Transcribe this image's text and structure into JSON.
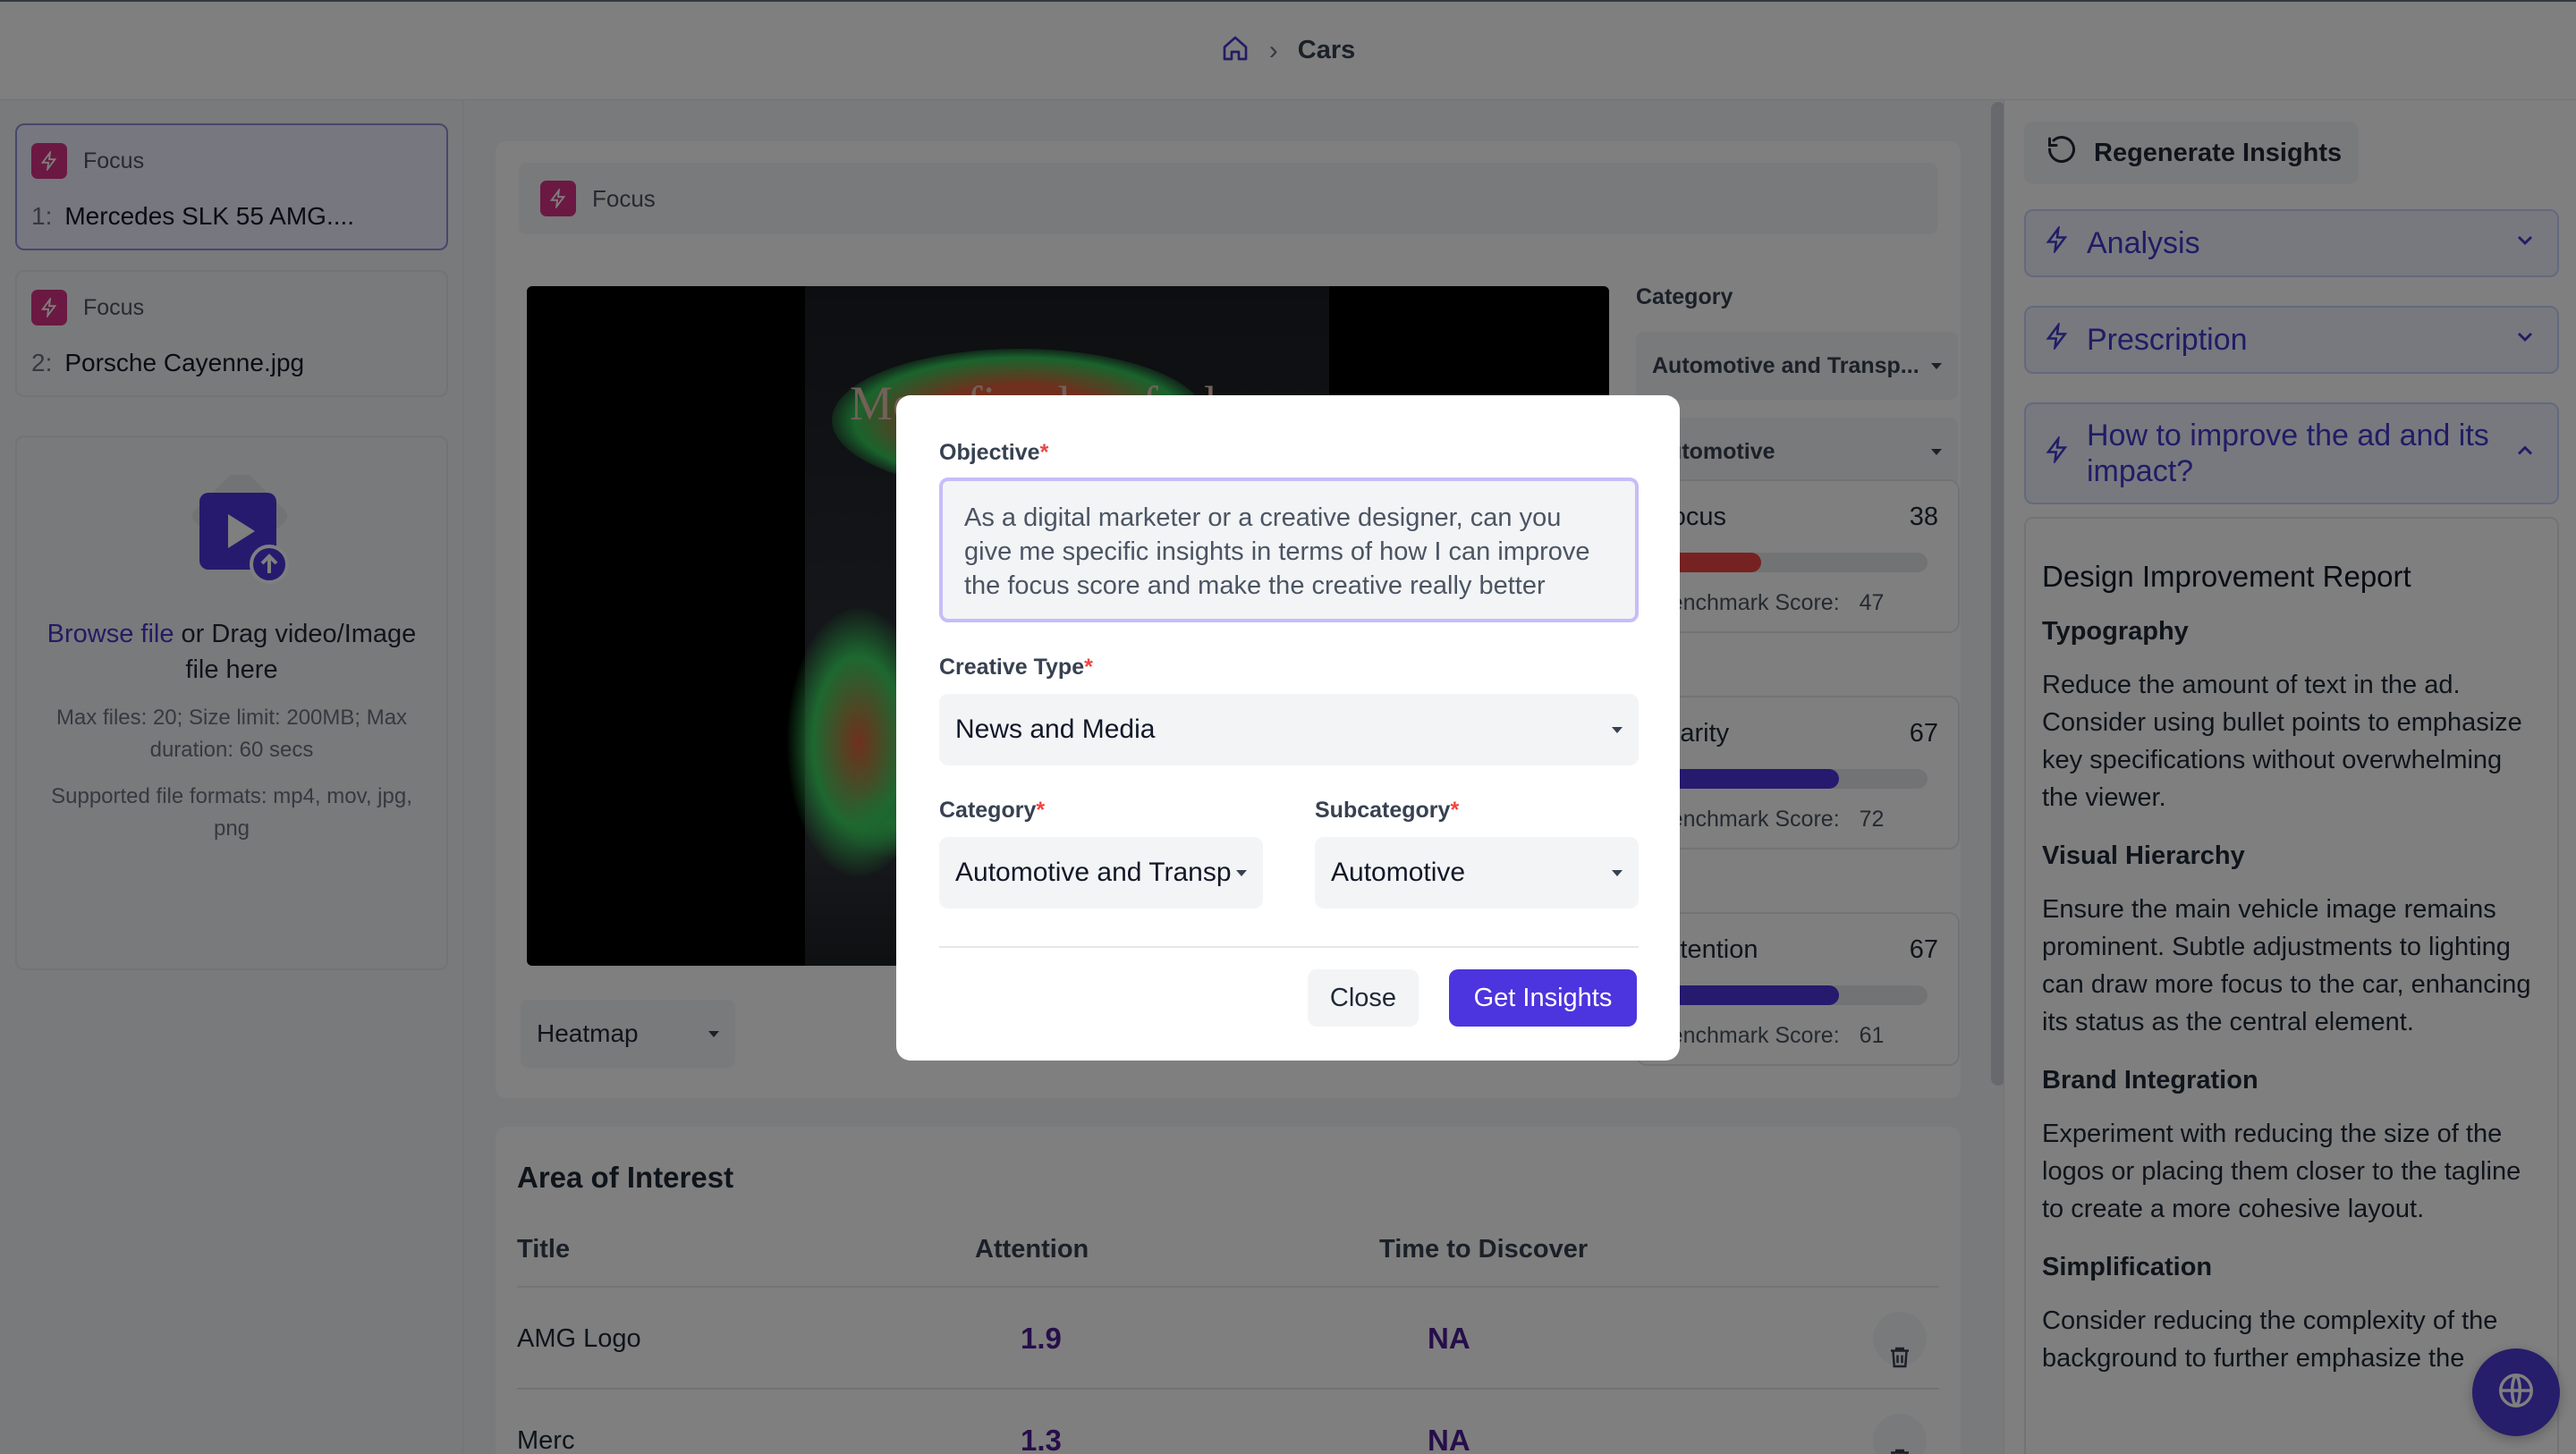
{
  "breadcrumb": {
    "title": "Cars"
  },
  "files": [
    {
      "index": "1:",
      "name": "Mercedes SLK 55 AMG....",
      "tag": "Focus"
    },
    {
      "index": "2:",
      "name": "Porsche Cayenne.jpg",
      "tag": "Focus"
    }
  ],
  "upload": {
    "browse": "Browse file",
    "rest": " or Drag video/Image file here",
    "limits": "Max files: 20; Size limit: 200MB; Max duration: 60 secs",
    "formats": "Supported file formats: mp4, mov, jpg, png"
  },
  "panel": {
    "tag": "Focus",
    "poster_headline": "More fire, less fuel",
    "view_mode": "Heatmap",
    "category_label": "Category",
    "category_value": "Automotive and Transp...",
    "subcategory_value": "Automotive"
  },
  "metrics": [
    {
      "name": "Focus",
      "value": "38",
      "bench_label": "Benchmark Score:",
      "bench": "47",
      "fill": 0.38,
      "color": "#ef4444"
    },
    {
      "name": "Clarity",
      "value": "67",
      "bench_label": "Benchmark Score:",
      "bench": "72",
      "fill": 0.67,
      "color": "#4c35de"
    },
    {
      "name": "Attention",
      "value": "67",
      "bench_label": "Benchmark Score:",
      "bench": "61",
      "fill": 0.67,
      "color": "#4c35de"
    }
  ],
  "aoi": {
    "title": "Area of Interest",
    "headers": {
      "title": "Title",
      "attention": "Attention",
      "time": "Time to Discover"
    },
    "rows": [
      {
        "title": "AMG Logo",
        "attention": "1.9",
        "time": "NA"
      },
      {
        "title": "Merc",
        "attention": "1.3",
        "time": "NA"
      }
    ]
  },
  "right": {
    "regenerate": "Regenerate Insights",
    "accordions": [
      "Analysis",
      "Prescription",
      "How to improve the ad and its impact?"
    ],
    "report_title": "Design Improvement Report",
    "sections": [
      {
        "h": "Typography",
        "p": "Reduce the amount of text in the ad. Consider using bullet points to emphasize key specifications without overwhelming the viewer."
      },
      {
        "h": "Visual Hierarchy",
        "p": "Ensure the main vehicle image remains prominent. Subtle adjustments to lighting can draw more focus to the car, enhancing its status as the central element."
      },
      {
        "h": "Brand Integration",
        "p": "Experiment with reducing the size of the logos or placing them closer to the tagline to create a more cohesive layout."
      },
      {
        "h": "Simplification",
        "p": "Consider reducing the complexity of the background to further emphasize the"
      }
    ]
  },
  "modal": {
    "objective_label": "Objective",
    "objective_value": "As a digital marketer or a creative designer, can you give me specific insights in terms of how I can improve the focus score and make the creative really better",
    "creative_type_label": "Creative Type",
    "creative_type_value": "News and Media",
    "category_label": "Category",
    "category_value": "Automotive and Transp",
    "subcategory_label": "Subcategory",
    "subcategory_value": "Automotive",
    "required_mark": "*",
    "close": "Close",
    "get_insights": "Get Insights"
  },
  "colors": {
    "accent": "#4c35de",
    "focus_tag": "#d63384",
    "link": "#4338ca"
  }
}
